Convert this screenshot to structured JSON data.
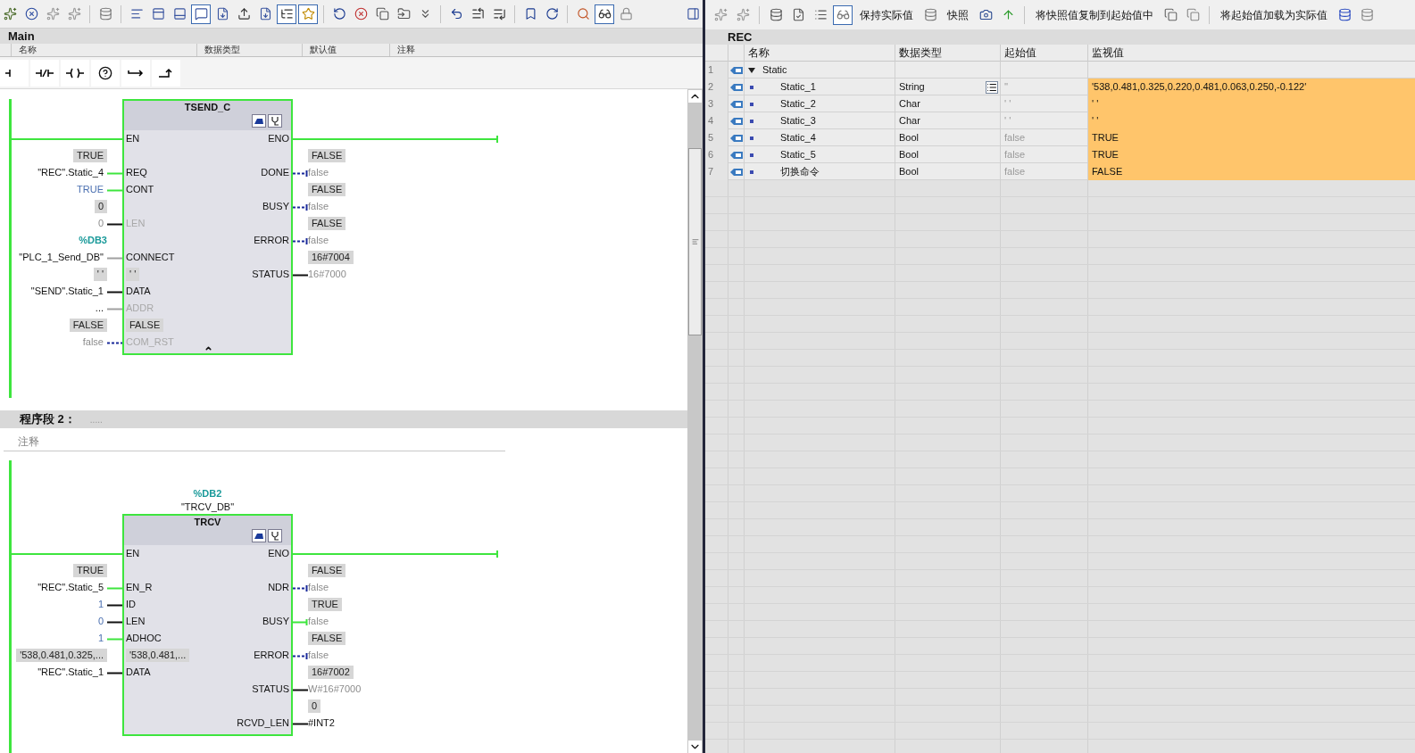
{
  "editor": {
    "title": "Main",
    "interface_columns": [
      "名称",
      "数据类型",
      "默认值",
      "注释"
    ],
    "networks": [
      {
        "blocks": [
          {
            "type_name": "TSEND_C",
            "collapsible": true,
            "inputs": [
              {
                "kind": "enable",
                "name": "EN"
              },
              {
                "kind": "param",
                "name": "REQ",
                "monitor": "TRUE",
                "operand": "\"REC\".Static_4",
                "constant": false,
                "default_operand": false,
                "color": "#3ee53e",
                "dashed": false,
                "dimmed": false
              },
              {
                "kind": "param",
                "name": "CONT",
                "operand": "TRUE",
                "constant": true,
                "color": "#3ee53e",
                "dashed": false,
                "dimmed": false
              },
              {
                "kind": "param",
                "name": "LEN",
                "monitor": "0",
                "operand": "0",
                "constant": false,
                "default_operand": true,
                "color": "#111111",
                "dashed": false,
                "dimmed": true
              },
              {
                "kind": "param",
                "name": "CONNECT",
                "db_number": "%DB3",
                "operand": "\"PLC_1_Send_DB\"",
                "constant": false,
                "default_operand": false,
                "color": "#a0a0a0",
                "dashed": false,
                "dimmed": false
              },
              {
                "kind": "param",
                "name": "DATA",
                "monitor": "' '",
                "inner_monitor": "' '",
                "operand": "\"SEND\".Static_1",
                "constant": false,
                "default_operand": false,
                "color": "#111111",
                "dashed": false,
                "dimmed": false
              },
              {
                "kind": "param",
                "name": "ADDR",
                "operand": "...",
                "constant": false,
                "default_operand": false,
                "color": "#a0a0a0",
                "dashed": false,
                "dimmed": true
              },
              {
                "kind": "param",
                "name": "COM_RST",
                "monitor": "FALSE",
                "inner_monitor": "FALSE",
                "operand": "false",
                "constant": false,
                "default_operand": true,
                "color": "#1a2a9a",
                "dashed": true,
                "dimmed": true
              }
            ],
            "outputs": [
              {
                "kind": "enable",
                "name": "ENO"
              },
              {
                "kind": "param",
                "name": "DONE",
                "monitor": "FALSE",
                "operand": "false",
                "default_operand": true,
                "color": "#1a2a9a",
                "dashed": true
              },
              {
                "kind": "param",
                "name": "BUSY",
                "monitor": "FALSE",
                "operand": "false",
                "default_operand": true,
                "color": "#1a2a9a",
                "dashed": true
              },
              {
                "kind": "param",
                "name": "ERROR",
                "monitor": "FALSE",
                "operand": "false",
                "default_operand": true,
                "color": "#1a2a9a",
                "dashed": true
              },
              {
                "kind": "param",
                "name": "STATUS",
                "monitor": "16#7004",
                "operand": "16#7000",
                "default_operand": true,
                "color": "#111111",
                "dashed": false
              }
            ]
          }
        ]
      },
      {
        "title": "程序段 2：",
        "description": ".....",
        "comment": "注释",
        "blocks": [
          {
            "instance_db": "%DB2",
            "instance_name": "\"TRCV_DB\"",
            "type_name": "TRCV",
            "collapsible": false,
            "inputs": [
              {
                "kind": "enable",
                "name": "EN"
              },
              {
                "kind": "param",
                "name": "EN_R",
                "monitor": "TRUE",
                "operand": "\"REC\".Static_5",
                "constant": false,
                "default_operand": false,
                "color": "#3ee53e",
                "dashed": false,
                "dimmed": false
              },
              {
                "kind": "param",
                "name": "ID",
                "operand": "1",
                "constant": true,
                "color": "#111111",
                "dashed": false,
                "dimmed": false
              },
              {
                "kind": "param",
                "name": "LEN",
                "operand": "0",
                "constant": true,
                "color": "#111111",
                "dashed": false,
                "dimmed": false
              },
              {
                "kind": "param",
                "name": "ADHOC",
                "operand": "1",
                "constant": true,
                "color": "#3ee53e",
                "dashed": false,
                "dimmed": false
              },
              {
                "kind": "param",
                "name": "DATA",
                "monitor": "'538,0.481,0.325,...",
                "inner_monitor": "'538,0.481,...",
                "operand": "\"REC\".Static_1",
                "constant": false,
                "default_operand": false,
                "color": "#111111",
                "dashed": false,
                "dimmed": false
              }
            ],
            "outputs": [
              {
                "kind": "enable",
                "name": "ENO"
              },
              {
                "kind": "param",
                "name": "NDR",
                "monitor": "FALSE",
                "operand": "false",
                "default_operand": true,
                "color": "#1a2a9a",
                "dashed": true
              },
              {
                "kind": "param",
                "name": "BUSY",
                "monitor": "TRUE",
                "operand": "false",
                "default_operand": true,
                "color": "#3ee53e",
                "dashed": false
              },
              {
                "kind": "param",
                "name": "ERROR",
                "monitor": "FALSE",
                "operand": "false",
                "default_operand": true,
                "color": "#1a2a9a",
                "dashed": true
              },
              {
                "kind": "param",
                "name": "STATUS",
                "monitor": "16#7002",
                "operand": "W#16#7000",
                "default_operand": true,
                "color": "#111111",
                "dashed": false
              },
              {
                "kind": "param",
                "name": "RCVD_LEN",
                "monitor": "0",
                "operand": "#INT2",
                "default_operand": false,
                "color": "#111111",
                "dashed": false
              }
            ]
          }
        ]
      }
    ]
  },
  "watch_table": {
    "toolbar": [
      "保持实际值",
      "快照",
      "将快照值复制到起始值中",
      "将起始值加载为实际值"
    ],
    "title": "REC",
    "columns": [
      "名称",
      "数据类型",
      "起始值",
      "监视值"
    ],
    "rows": [
      {
        "no": "1",
        "name": "Static",
        "expanded": true,
        "children": [
          {
            "no": "2",
            "name": "Static_1",
            "data_type": "String",
            "value_editor": true,
            "start_value": "''",
            "monitor_value": "'538,0.481,0.325,0.220,0.481,0.063,0.250,-0.122'"
          },
          {
            "no": "3",
            "name": "Static_2",
            "data_type": "Char",
            "value_editor": false,
            "start_value": "' '",
            "monitor_value": "' '"
          },
          {
            "no": "4",
            "name": "Static_3",
            "data_type": "Char",
            "value_editor": false,
            "start_value": "' '",
            "monitor_value": "' '"
          },
          {
            "no": "5",
            "name": "Static_4",
            "data_type": "Bool",
            "value_editor": false,
            "start_value": "false",
            "monitor_value": "TRUE"
          },
          {
            "no": "6",
            "name": "Static_5",
            "data_type": "Bool",
            "value_editor": false,
            "start_value": "false",
            "monitor_value": "TRUE"
          },
          {
            "no": "7",
            "name": "切换命令",
            "data_type": "Bool",
            "value_editor": false,
            "start_value": "false",
            "monitor_value": "FALSE"
          }
        ]
      }
    ]
  }
}
